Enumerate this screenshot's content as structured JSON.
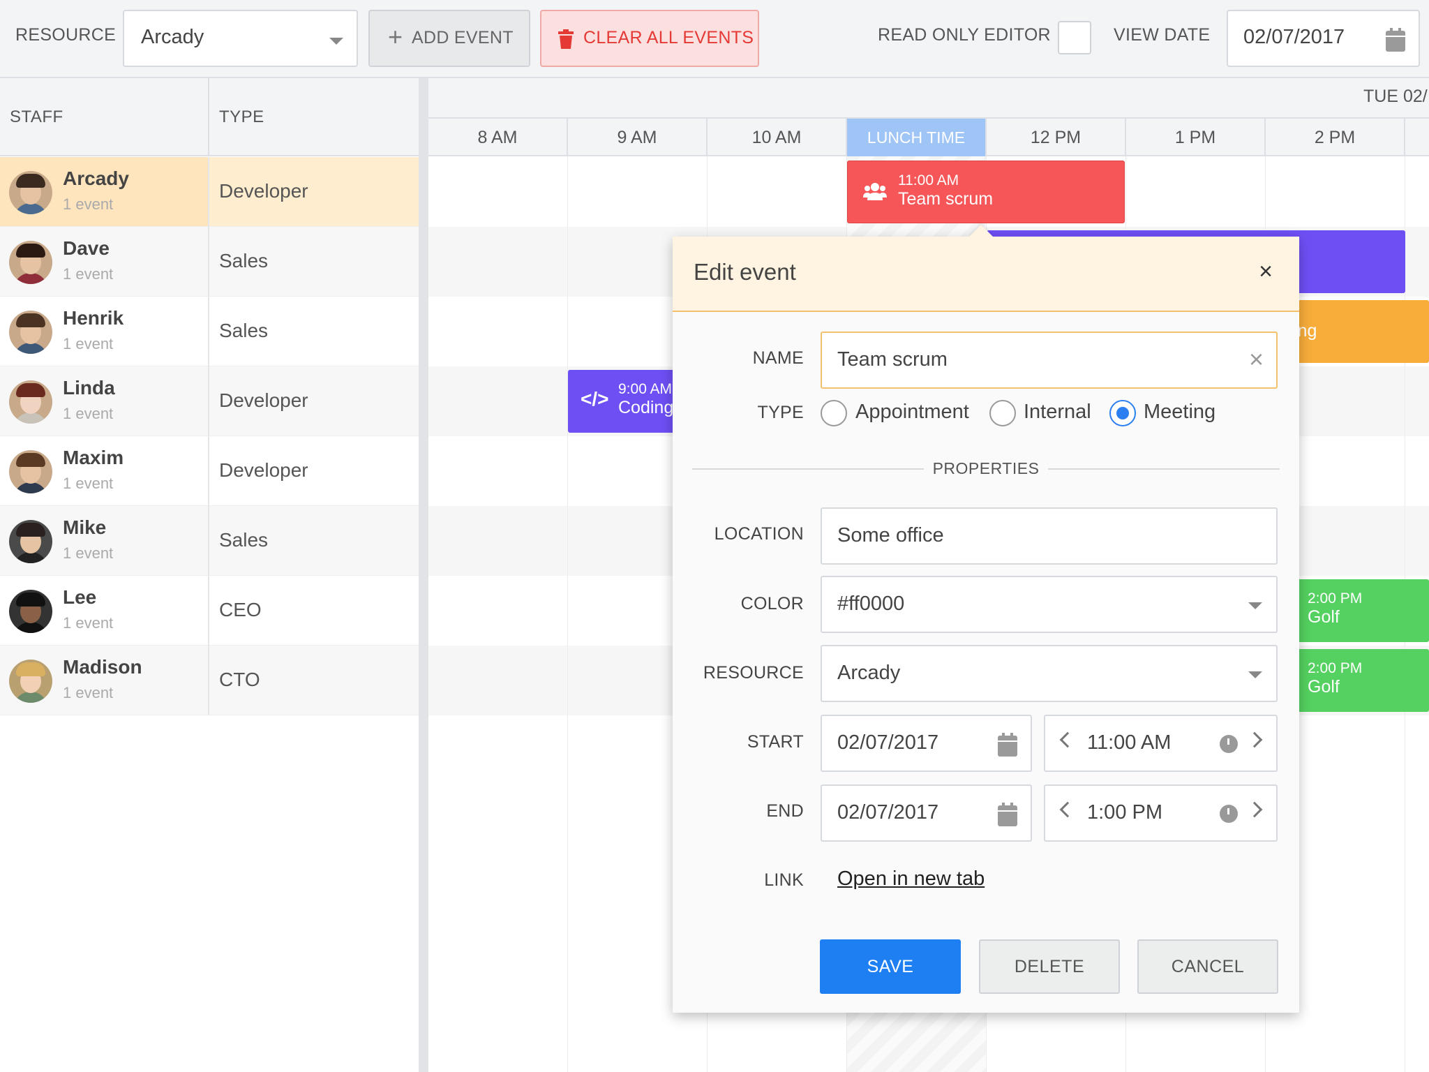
{
  "toolbar": {
    "resource_label": "RESOURCE",
    "resource_value": "Arcady",
    "add_event": "ADD EVENT",
    "clear_all": "CLEAR ALL EVENTS",
    "read_only": "READ ONLY EDITOR",
    "view_date_label": "VIEW DATE",
    "view_date": "02/07/2017"
  },
  "grid": {
    "col_staff": "STAFF",
    "col_type": "TYPE",
    "date_header": "TUE 02/",
    "times": [
      "8 AM",
      "9 AM",
      "10 AM",
      "LUNCH TIME",
      "12 PM",
      "1 PM",
      "2 PM"
    ]
  },
  "staff": [
    {
      "name": "Arcady",
      "sub": "1 event",
      "type": "Developer"
    },
    {
      "name": "Dave",
      "sub": "1 event",
      "type": "Sales"
    },
    {
      "name": "Henrik",
      "sub": "1 event",
      "type": "Sales"
    },
    {
      "name": "Linda",
      "sub": "1 event",
      "type": "Developer"
    },
    {
      "name": "Maxim",
      "sub": "1 event",
      "type": "Developer"
    },
    {
      "name": "Mike",
      "sub": "1 event",
      "type": "Sales"
    },
    {
      "name": "Lee",
      "sub": "1 event",
      "type": "CEO"
    },
    {
      "name": "Madison",
      "sub": "1 event",
      "type": "CTO"
    }
  ],
  "events": [
    {
      "time": "11:00 AM",
      "name": "Team scrum",
      "color": "#f65657"
    },
    {
      "time": "9:00 AM",
      "name": "Coding",
      "color": "#6e4ff4"
    },
    {
      "fragment": "ing",
      "color": "#f8ad3b"
    },
    {
      "time": "2:00 PM",
      "name": "Golf",
      "color": "#54d160"
    },
    {
      "time": "2:00 PM",
      "name": "Golf",
      "color": "#54d160"
    },
    {
      "color": "#6e4ff4"
    }
  ],
  "dialog": {
    "title": "Edit event",
    "close": "×",
    "name_label": "NAME",
    "name_value": "Team scrum",
    "type_label": "TYPE",
    "type_options": [
      "Appointment",
      "Internal",
      "Meeting"
    ],
    "type_selected": "Meeting",
    "properties": "PROPERTIES",
    "location_label": "LOCATION",
    "location_value": "Some office",
    "color_label": "COLOR",
    "color_value": "#ff0000",
    "resource_label": "RESOURCE",
    "resource_value": "Arcady",
    "start_label": "START",
    "start_date": "02/07/2017",
    "start_time": "11:00 AM",
    "end_label": "END",
    "end_date": "02/07/2017",
    "end_time": "1:00 PM",
    "link_label": "LINK",
    "link_text": "Open in new tab",
    "save": "SAVE",
    "delete": "DELETE",
    "cancel": "CANCEL"
  }
}
